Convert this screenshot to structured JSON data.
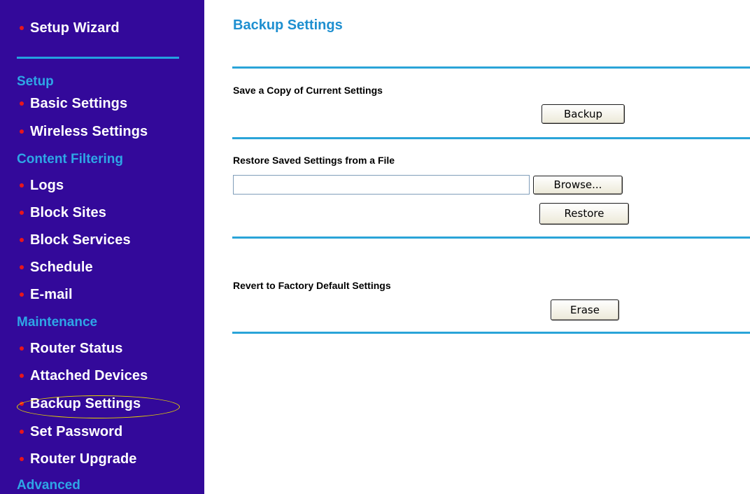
{
  "sidebar": {
    "setup_wizard": "Setup Wizard",
    "sections": {
      "setup": "Setup",
      "content_filtering": "Content Filtering",
      "maintenance": "Maintenance",
      "advanced": "Advanced"
    },
    "items": {
      "basic_settings": "Basic Settings",
      "wireless_settings": "Wireless Settings",
      "logs": "Logs",
      "block_sites": "Block Sites",
      "block_services": "Block Services",
      "schedule": "Schedule",
      "email": "E-mail",
      "router_status": "Router Status",
      "attached_devices": "Attached Devices",
      "backup_settings": "Backup Settings",
      "set_password": "Set Password",
      "router_upgrade": "Router Upgrade"
    },
    "colors": {
      "background": "#33099a",
      "section_head": "#2ea6e6",
      "bullet": "#e8161b",
      "highlight": "#e6d200"
    }
  },
  "main": {
    "title": "Backup Settings",
    "save_copy_label": "Save a Copy of Current Settings",
    "backup_button": "Backup",
    "restore_label": "Restore Saved Settings from a File",
    "file_value": "",
    "browse_button": "Browse...",
    "restore_button": "Restore",
    "revert_label": "Revert to Factory Default Settings",
    "erase_button": "Erase",
    "colors": {
      "title": "#1e8fd0",
      "rule": "#2aa4d8"
    }
  }
}
